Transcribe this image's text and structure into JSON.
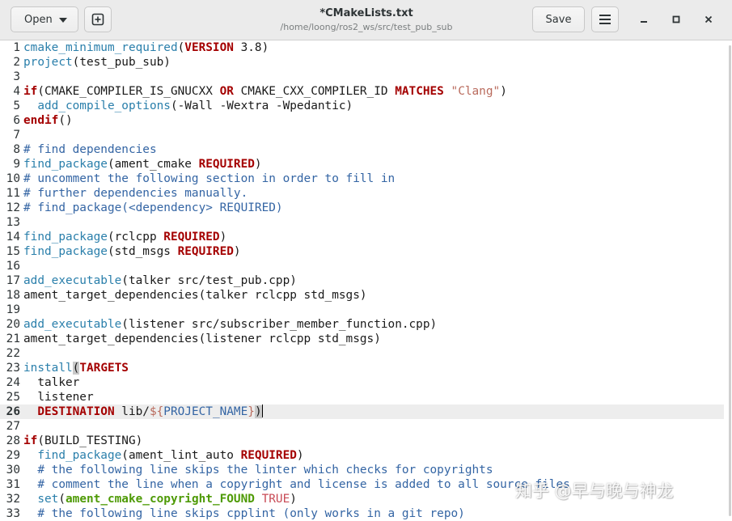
{
  "header": {
    "open_label": "Open",
    "save_label": "Save",
    "title": "*CMakeLists.txt",
    "subtitle": "/home/loong/ros2_ws/src/test_pub_sub",
    "icons": {
      "new_tab": "new-tab-icon",
      "menu": "hamburger-menu-icon",
      "minimize": "minimize-icon",
      "maximize": "maximize-icon",
      "close": "close-icon"
    }
  },
  "editor": {
    "current_line": 26,
    "lines": [
      {
        "n": "1",
        "tokens": [
          [
            "fn",
            "cmake_minimum_required"
          ],
          [
            "",
            "("
          ],
          [
            "kw",
            "VERSION"
          ],
          [
            "",
            " 3.8)"
          ]
        ]
      },
      {
        "n": "2",
        "tokens": [
          [
            "fn",
            "project"
          ],
          [
            "",
            "(test_pub_sub)"
          ]
        ]
      },
      {
        "n": "3",
        "tokens": []
      },
      {
        "n": "4",
        "tokens": [
          [
            "kw",
            "if"
          ],
          [
            "",
            "(CMAKE_COMPILER_IS_GNUCXX "
          ],
          [
            "kw",
            "OR"
          ],
          [
            "",
            " CMAKE_CXX_COMPILER_ID "
          ],
          [
            "kw",
            "MATCHES"
          ],
          [
            "",
            " "
          ],
          [
            "str",
            "\"Clang\""
          ],
          [
            "",
            ")"
          ]
        ]
      },
      {
        "n": "5",
        "tokens": [
          [
            "",
            "  "
          ],
          [
            "fn",
            "add_compile_options"
          ],
          [
            "",
            "(-Wall -Wextra -Wpedantic)"
          ]
        ]
      },
      {
        "n": "6",
        "tokens": [
          [
            "kw",
            "endif"
          ],
          [
            "",
            "()"
          ]
        ]
      },
      {
        "n": "7",
        "tokens": []
      },
      {
        "n": "8",
        "tokens": [
          [
            "com",
            "# find dependencies"
          ]
        ]
      },
      {
        "n": "9",
        "tokens": [
          [
            "fn",
            "find_package"
          ],
          [
            "",
            "(ament_cmake "
          ],
          [
            "req",
            "REQUIRED"
          ],
          [
            "",
            ")"
          ]
        ]
      },
      {
        "n": "10",
        "tokens": [
          [
            "com",
            "# uncomment the following section in order to fill in"
          ]
        ]
      },
      {
        "n": "11",
        "tokens": [
          [
            "com",
            "# further dependencies manually."
          ]
        ]
      },
      {
        "n": "12",
        "tokens": [
          [
            "com",
            "# find_package(<dependency> REQUIRED)"
          ]
        ]
      },
      {
        "n": "13",
        "tokens": []
      },
      {
        "n": "14",
        "tokens": [
          [
            "fn",
            "find_package"
          ],
          [
            "",
            "(rclcpp "
          ],
          [
            "req",
            "REQUIRED"
          ],
          [
            "",
            ")"
          ]
        ]
      },
      {
        "n": "15",
        "tokens": [
          [
            "fn",
            "find_package"
          ],
          [
            "",
            "(std_msgs "
          ],
          [
            "req",
            "REQUIRED"
          ],
          [
            "",
            ")"
          ]
        ]
      },
      {
        "n": "16",
        "tokens": []
      },
      {
        "n": "17",
        "tokens": [
          [
            "fn",
            "add_executable"
          ],
          [
            "",
            "(talker src/test_pub.cpp)"
          ]
        ]
      },
      {
        "n": "18",
        "tokens": [
          [
            "",
            "ament_target_dependencies(talker rclcpp std_msgs)"
          ]
        ]
      },
      {
        "n": "19",
        "tokens": []
      },
      {
        "n": "20",
        "tokens": [
          [
            "fn",
            "add_executable"
          ],
          [
            "",
            "(listener src/subscriber_member_function.cpp)"
          ]
        ]
      },
      {
        "n": "21",
        "tokens": [
          [
            "",
            "ament_target_dependencies(listener rclcpp std_msgs)"
          ]
        ]
      },
      {
        "n": "22",
        "tokens": []
      },
      {
        "n": "23",
        "tokens": [
          [
            "fn",
            "install"
          ],
          [
            "br",
            "("
          ],
          [
            "kw",
            "TARGETS"
          ]
        ]
      },
      {
        "n": "24",
        "tokens": [
          [
            "",
            "  talker"
          ]
        ]
      },
      {
        "n": "25",
        "tokens": [
          [
            "",
            "  listener"
          ]
        ]
      },
      {
        "n": "26",
        "tokens": [
          [
            "",
            "  "
          ],
          [
            "kw",
            "DESTINATION"
          ],
          [
            "",
            " lib/"
          ],
          [
            "str",
            "${"
          ],
          [
            "var",
            "PROJECT_NAME"
          ],
          [
            "str",
            "}"
          ],
          [
            "br",
            ")"
          ],
          [
            "cursor",
            ""
          ]
        ]
      },
      {
        "n": "27",
        "tokens": []
      },
      {
        "n": "28",
        "tokens": [
          [
            "kw",
            "if"
          ],
          [
            "",
            "(BUILD_TESTING)"
          ]
        ]
      },
      {
        "n": "29",
        "tokens": [
          [
            "",
            "  "
          ],
          [
            "fn",
            "find_package"
          ],
          [
            "",
            "(ament_lint_auto "
          ],
          [
            "req",
            "REQUIRED"
          ],
          [
            "",
            ")"
          ]
        ]
      },
      {
        "n": "30",
        "tokens": [
          [
            "",
            "  "
          ],
          [
            "com",
            "# the following line skips the linter which checks for copyrights"
          ]
        ]
      },
      {
        "n": "31",
        "tokens": [
          [
            "",
            "  "
          ],
          [
            "com",
            "# comment the line when a copyright and license is added to all source files"
          ]
        ]
      },
      {
        "n": "32",
        "tokens": [
          [
            "",
            "  "
          ],
          [
            "fn",
            "set"
          ],
          [
            "",
            "("
          ],
          [
            "grn",
            "ament_cmake_copyright_FOUND"
          ],
          [
            "",
            " "
          ],
          [
            "bool",
            "TRUE"
          ],
          [
            "",
            ")"
          ]
        ]
      },
      {
        "n": "33",
        "tokens": [
          [
            "",
            "  "
          ],
          [
            "com",
            "# the following line skips cpplint (only works in a git repo)"
          ]
        ]
      }
    ]
  },
  "watermark": {
    "text": "知乎 @早与晚与神龙"
  }
}
